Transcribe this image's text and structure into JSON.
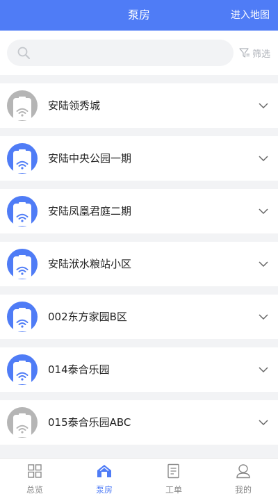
{
  "header": {
    "title": "泵房",
    "map_link": "进入地图"
  },
  "search": {
    "placeholder": "",
    "filter_label": "筛选"
  },
  "stations": [
    {
      "name": "安陆领秀城",
      "online": false
    },
    {
      "name": "安陆中央公园一期",
      "online": true
    },
    {
      "name": "安陆凤凰君庭二期",
      "online": true
    },
    {
      "name": "安陆洑水粮站小区",
      "online": true
    },
    {
      "name": "002东方家园B区",
      "online": true
    },
    {
      "name": "014泰合乐园",
      "online": true
    },
    {
      "name": "015泰合乐园ABC",
      "online": false
    }
  ],
  "tabs": [
    {
      "label": "总览",
      "icon": "grid-icon"
    },
    {
      "label": "泵房",
      "icon": "home-icon",
      "active": true
    },
    {
      "label": "工单",
      "icon": "document-icon"
    },
    {
      "label": "我的",
      "icon": "user-icon"
    }
  ],
  "colors": {
    "accent": "#4f7cf6",
    "offline": "#b5b5b5"
  }
}
